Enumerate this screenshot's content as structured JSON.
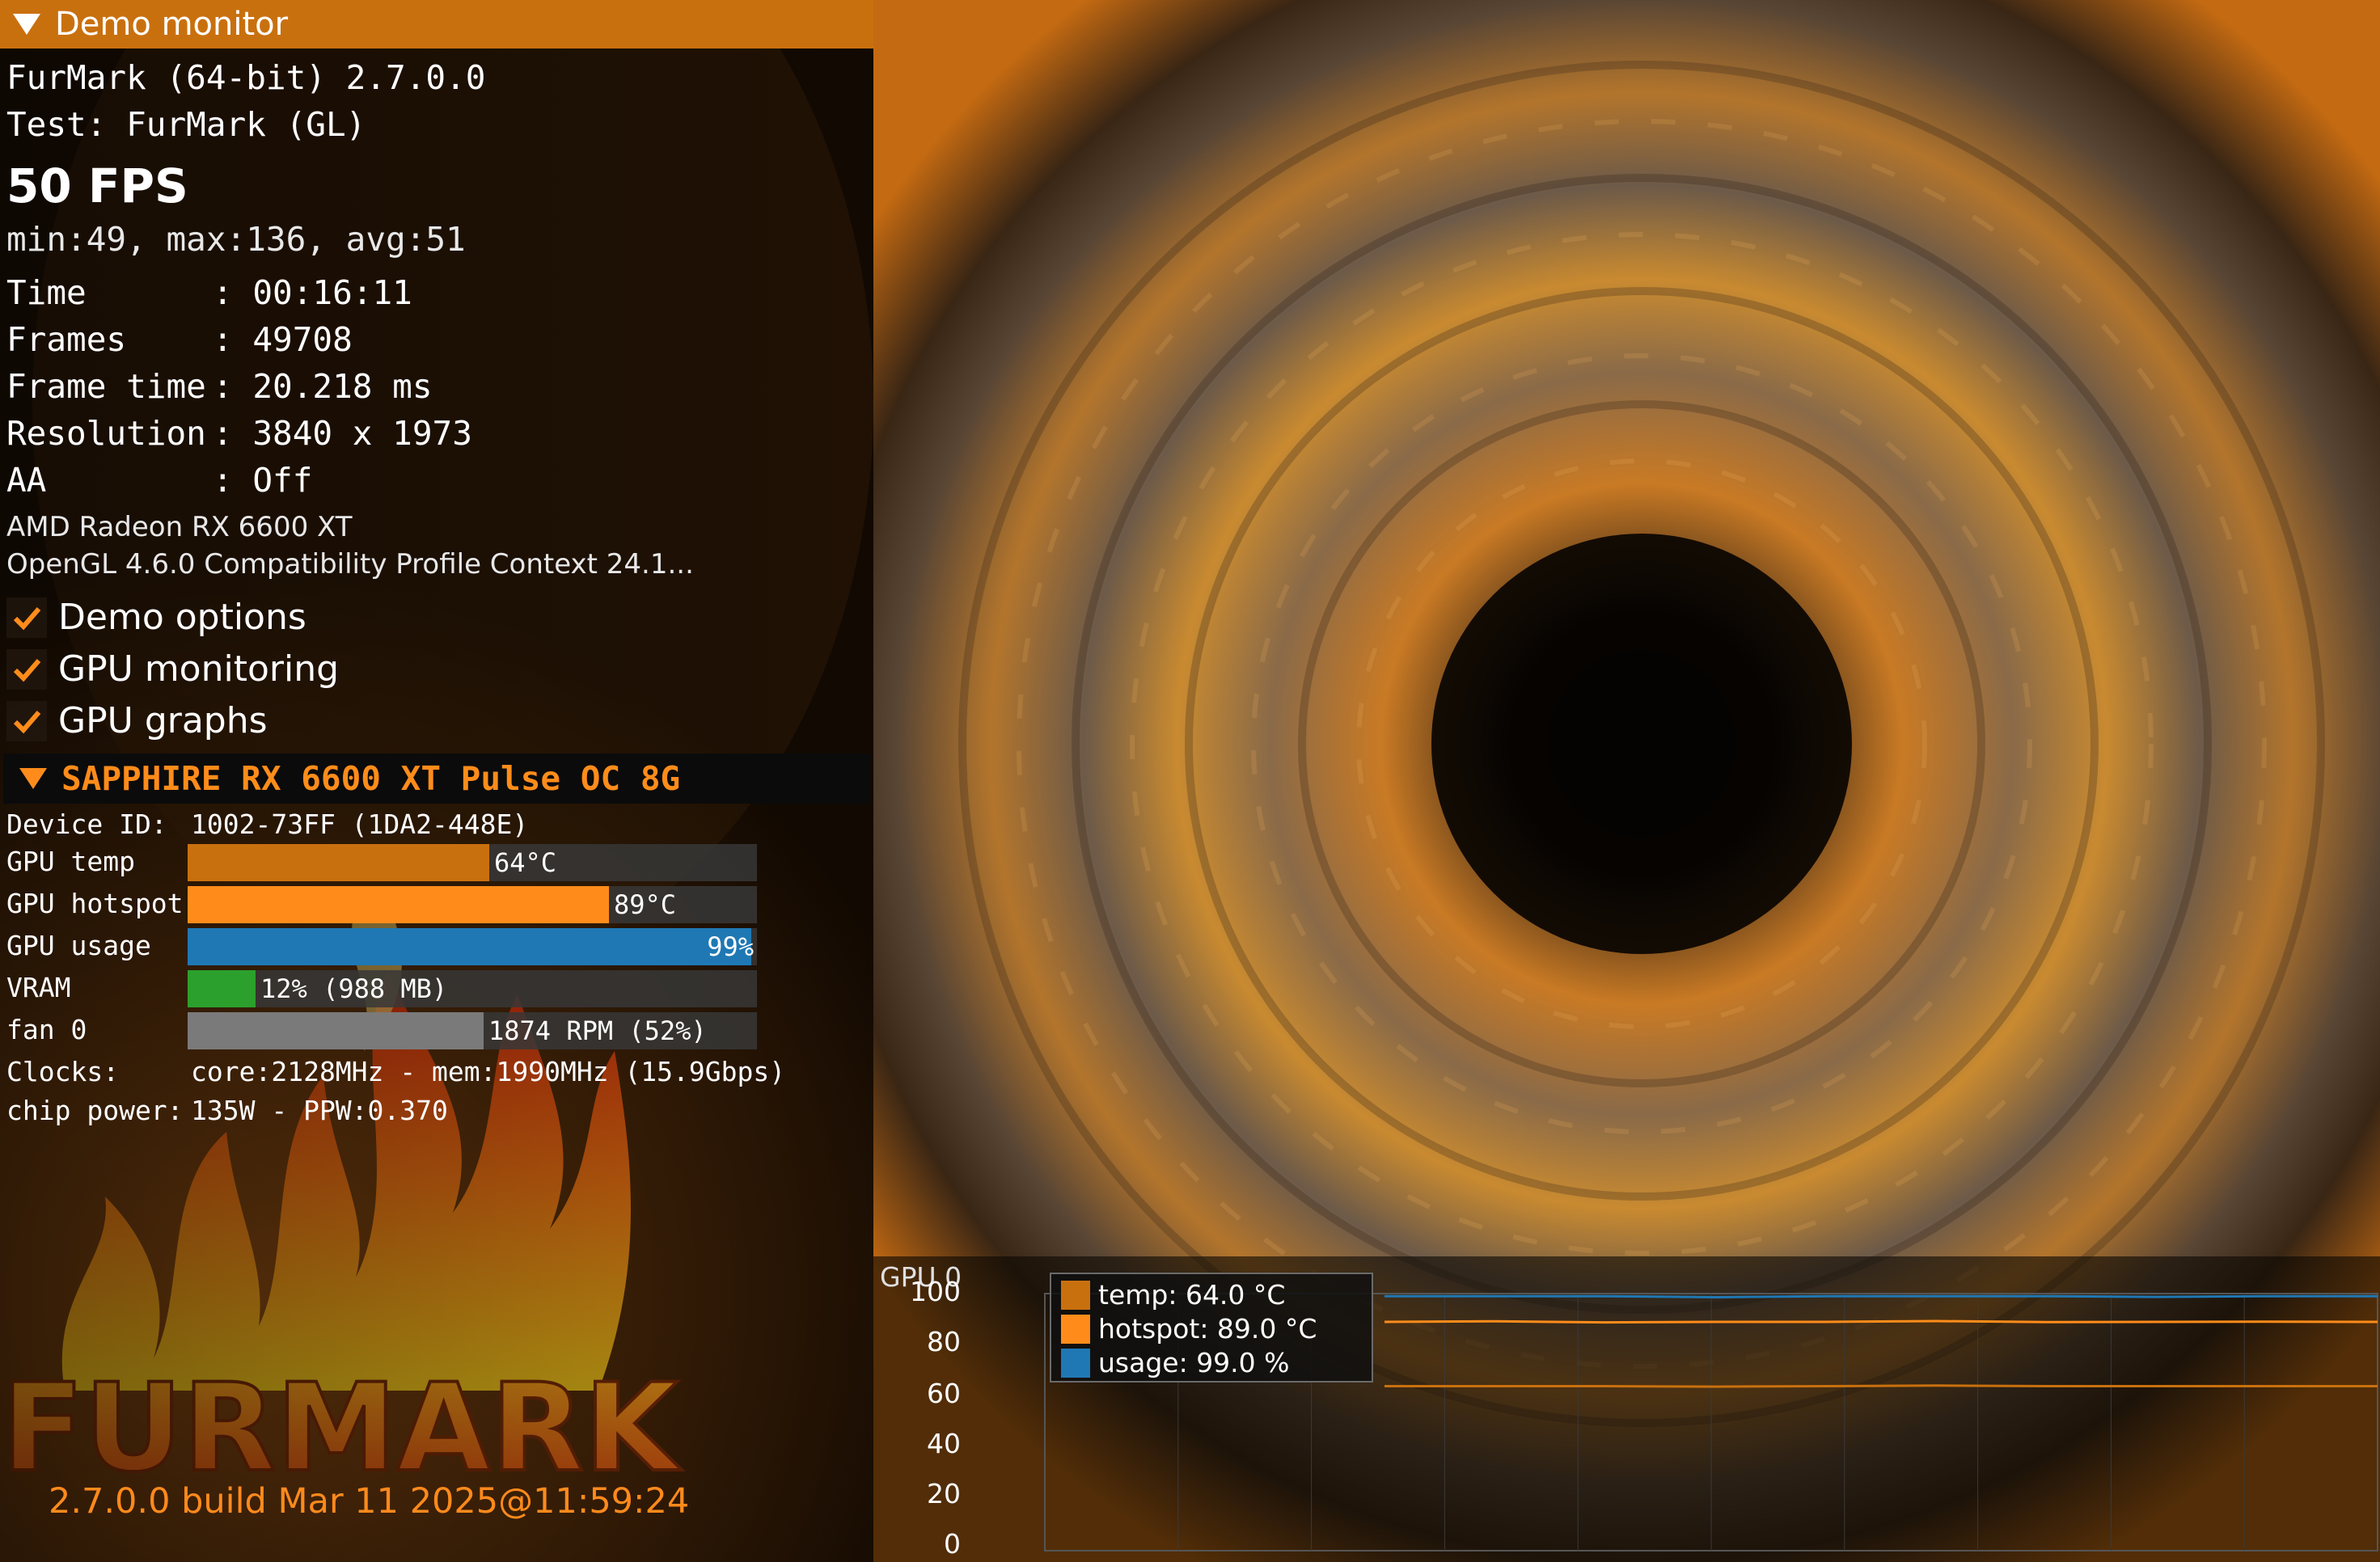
{
  "window_title": "Demo monitor",
  "app": {
    "name_line": "FurMark (64-bit) 2.7.0.0",
    "test_line": "Test: FurMark (GL)",
    "fps": "50 FPS",
    "fps_stats": "min:49, max:136, avg:51"
  },
  "stats": [
    {
      "key": "Time",
      "value": ": 00:16:11"
    },
    {
      "key": "Frames",
      "value": ": 49708"
    },
    {
      "key": "Frame time",
      "value": ": 20.218 ms"
    },
    {
      "key": "Resolution",
      "value": ": 3840 x 1973"
    },
    {
      "key": "AA",
      "value": ": Off"
    }
  ],
  "gpu_name": "AMD Radeon RX 6600 XT",
  "opengl": "OpenGL 4.6.0 Compatibility Profile Context 24.1...",
  "options": [
    {
      "label": "Demo options",
      "checked": true
    },
    {
      "label": "GPU monitoring",
      "checked": true
    },
    {
      "label": "GPU graphs",
      "checked": true
    }
  ],
  "gpu_section": {
    "header": "SAPPHIRE RX 6600 XT Pulse OC 8G",
    "device_id_label": "Device ID:",
    "device_id": "1002-73FF (1DA2-448E)",
    "metrics": [
      {
        "label": "GPU temp",
        "text": "64°C",
        "fraction": 0.53,
        "color": "#c9700e"
      },
      {
        "label": "GPU hotspot",
        "text": "89°C",
        "fraction": 0.74,
        "color": "#ff8c1a"
      },
      {
        "label": "GPU usage",
        "text": "99%",
        "fraction": 0.99,
        "color": "#1f78b4"
      },
      {
        "label": "VRAM",
        "text": "12% (988 MB)",
        "fraction": 0.12,
        "color": "#2ca02c"
      },
      {
        "label": "fan 0",
        "text": "1874 RPM (52%)",
        "fraction": 0.52,
        "color": "#7a7a7a"
      }
    ],
    "clocks_label": "Clocks:",
    "clocks": "core:2128MHz - mem:1990MHz (15.9Gbps)",
    "power_label": "chip power:",
    "power": "135W - PPW:0.370"
  },
  "logo_text": "FURMARK",
  "version": "2.7.0.0 build Mar 11 2025@11:59:24",
  "chart_data": {
    "type": "line",
    "title": "GPU 0",
    "xlabel": "",
    "ylabel": "",
    "ylim": [
      0,
      100
    ],
    "yticks": [
      "100",
      "80",
      "60",
      "40",
      "20",
      "0"
    ],
    "grid": true,
    "legend_position": "top-left",
    "series": [
      {
        "name": "temp: 64.0 °C",
        "color": "#c9700e",
        "values": [
          64,
          64,
          64,
          63.8,
          64,
          64.2,
          64,
          64,
          64,
          64
        ]
      },
      {
        "name": "hotspot: 89.0 °C",
        "color": "#ff8c1a",
        "values": [
          89,
          89.2,
          88.8,
          89,
          89,
          89.3,
          88.9,
          89,
          89.1,
          89
        ]
      },
      {
        "name": "usage: 99.0 %",
        "color": "#1f78b4",
        "values": [
          99,
          99,
          99,
          98.6,
          99,
          99,
          99,
          98.7,
          99,
          99
        ]
      }
    ]
  }
}
